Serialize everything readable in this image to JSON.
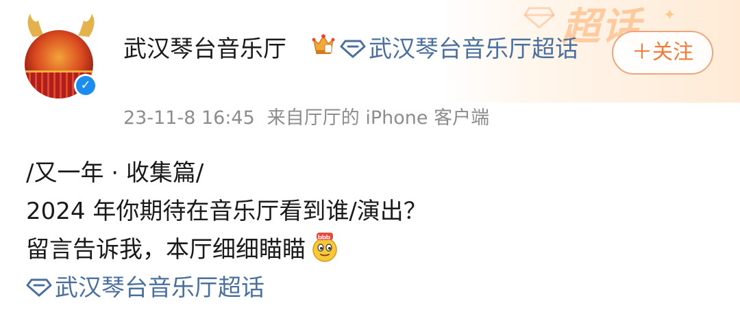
{
  "post": {
    "author": "武汉琴台音乐厅",
    "topic_tag": "武汉琴台音乐厅超话",
    "follow_label": "＋关注",
    "time": "23-11-8 16:45",
    "source": "来自厅厅的 iPhone 客户端",
    "banner_text": "超话",
    "content_lines": [
      "/又一年 · 收集篇/",
      "2024 年你期待在音乐厅看到谁/演出？",
      "留言告诉我，本厅细细瞄瞄"
    ],
    "footer_topic": "武汉琴台音乐厅超话"
  },
  "icons": {
    "verified": "verified-check-icon",
    "crown": "vip-crown-icon",
    "topic": "supertopic-diamond-icon",
    "emoji": "666-emoji-icon"
  },
  "colors": {
    "link": "#4a6f9e",
    "follow": "#f07a37",
    "verified": "#1d8cf0",
    "meta": "#8c8c8c"
  }
}
